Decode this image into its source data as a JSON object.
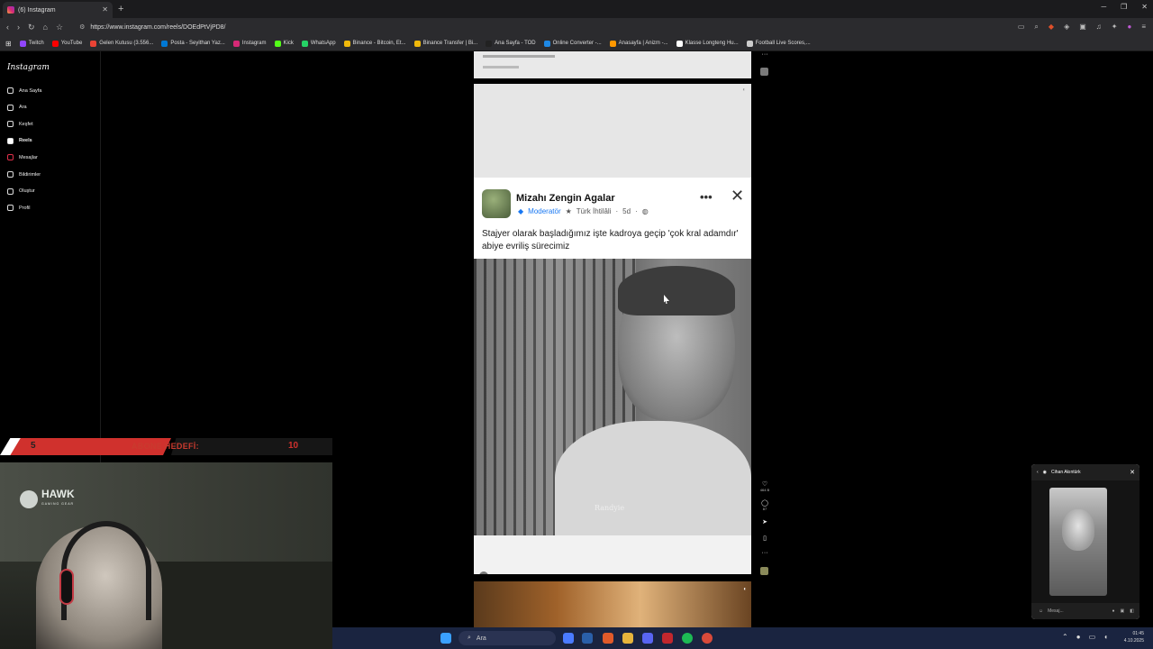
{
  "browser": {
    "tab_title": "(6) Instagram",
    "url": "https://www.instagram.com/reels/DOEdPtVjPD8/",
    "bookmarks": [
      {
        "label": "Twitch",
        "color": "#9146ff"
      },
      {
        "label": "YouTube",
        "color": "#ff0000"
      },
      {
        "label": "Gelen Kutusu (3.556...",
        "color": "#ea4335"
      },
      {
        "label": "Posta - Seyithan Yaz...",
        "color": "#0078d4"
      },
      {
        "label": "Instagram",
        "color": "#d62976"
      },
      {
        "label": "Kick",
        "color": "#53fc18"
      },
      {
        "label": "WhatsApp",
        "color": "#25d366"
      },
      {
        "label": "Binance - Bitcoin, Et...",
        "color": "#f0b90b"
      },
      {
        "label": "Binance Transfer | Bi...",
        "color": "#f0b90b"
      },
      {
        "label": "Ana Sayfa - TOD",
        "color": "#222222"
      },
      {
        "label": "Online Converter -...",
        "color": "#1e88e5"
      },
      {
        "label": "Anasayfa | Anizm -...",
        "color": "#ff9800"
      },
      {
        "label": "Klasse Longteng Hu...",
        "color": "#ffffff"
      },
      {
        "label": "Football Live Scores,...",
        "color": "#cccccc"
      }
    ]
  },
  "sidebar": {
    "logo": "Instagram",
    "items": [
      {
        "label": "Ana Sayfa",
        "icon": "home-icon"
      },
      {
        "label": "Ara",
        "icon": "search-icon"
      },
      {
        "label": "Keşfet",
        "icon": "compass-icon"
      },
      {
        "label": "Reels",
        "icon": "reels-icon"
      },
      {
        "label": "Mesajlar",
        "icon": "messenger-icon"
      },
      {
        "label": "Bildirimler",
        "icon": "heart-icon"
      },
      {
        "label": "Oluştur",
        "icon": "plus-icon"
      },
      {
        "label": "Profil",
        "icon": "profile-icon"
      }
    ]
  },
  "reel": {
    "post": {
      "group_name": "Mizahı Zengin Agalar",
      "role": "Moderatör",
      "author": "Türk İhtilâli",
      "age": "5d",
      "text": "Stajyer olarak başladığımız işte kadroya geçip 'çok kral adamdır' abiye evriliş sürecimiz"
    },
    "video_caption": "Randyie",
    "like_count": "464 B",
    "comment_count": "87"
  },
  "stream_overlay": {
    "goal_current": "5",
    "goal_label": "ABONE HEDEFİ:",
    "goal_target": "10",
    "webcam_brand": "HAWK",
    "webcam_brand_sub": "GAMING GEAR"
  },
  "floating_panel": {
    "title": "Cihan Akıntürk",
    "input_placeholder": "Mesaj..."
  },
  "taskbar": {
    "search_label": "Ara",
    "time": "01:45",
    "date": "4.10.2025"
  }
}
